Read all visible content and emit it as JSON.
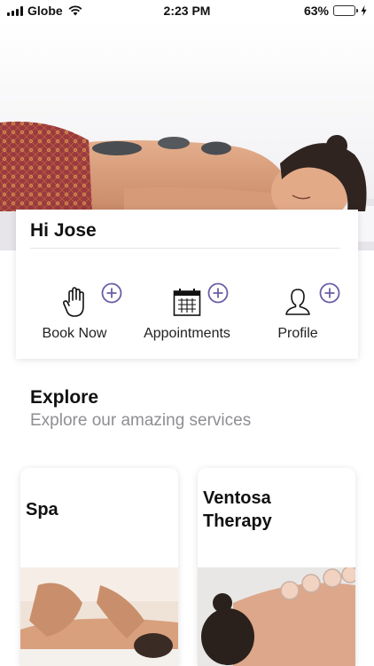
{
  "status_bar": {
    "carrier": "Globe",
    "time": "2:23 PM",
    "battery": "63%",
    "battery_level": 0.63
  },
  "greeting": "Hi Jose",
  "actions": [
    {
      "label": "Book Now",
      "icon": "hand-icon"
    },
    {
      "label": "Appointments",
      "icon": "calendar-icon"
    },
    {
      "label": "Profile",
      "icon": "person-icon"
    }
  ],
  "explore": {
    "title": "Explore",
    "subtitle": "Explore our amazing services"
  },
  "services": [
    {
      "title": "Spa"
    },
    {
      "title_line1": "Ventosa",
      "title_line2": "Therapy"
    }
  ],
  "colors": {
    "accent": "#6a5fa6",
    "battery": "#4cd964",
    "subtitle": "#8e8e93"
  }
}
